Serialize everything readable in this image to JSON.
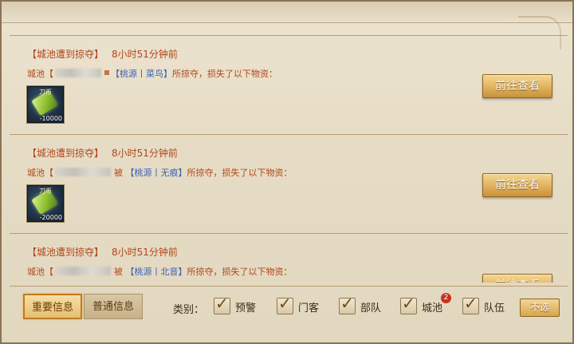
{
  "entries": [
    {
      "title": "【城池遭到掠夺】",
      "time": "8小时51分钟前",
      "city_prefix": "城池【",
      "joiner": "",
      "alliance": "【桃源丨菜鸟】",
      "suffix": "所掠夺，损失了以下物资：",
      "item_name": "刀币",
      "item_qty": "-10000",
      "button": "前往查看"
    },
    {
      "title": "【城池遭到掠夺】",
      "time": "8小时51分钟前",
      "city_prefix": "城池【",
      "joiner": "被",
      "alliance": "【桃源丨无痕】",
      "suffix": "所掠夺，损失了以下物资：",
      "item_name": "刀币",
      "item_qty": "-20000",
      "button": "前往查看"
    },
    {
      "title": "【城池遭到掠夺】",
      "time": "8小时51分钟前",
      "city_prefix": "城池【",
      "joiner": "被",
      "alliance": "【桃源丨北音】",
      "suffix": "所掠夺，损失了以下物资：",
      "button": "前往查看"
    }
  ],
  "tabs": {
    "important": "重要信息",
    "normal": "普通信息"
  },
  "category_label": "类别：",
  "filters": [
    {
      "label": "预警",
      "checked": true
    },
    {
      "label": "门客",
      "checked": true
    },
    {
      "label": "部队",
      "checked": true
    },
    {
      "label": "城池",
      "checked": true,
      "badge": "2"
    },
    {
      "label": "队伍",
      "checked": true
    }
  ],
  "deselect_all": "不选",
  "icons": {
    "item": "coin-voucher-icon",
    "check": "check-icon"
  },
  "colors": {
    "title_text": "#b1471c",
    "alliance_text": "#3a62b5",
    "button_gold": "#e2b560",
    "badge_red": "#c9311c"
  }
}
